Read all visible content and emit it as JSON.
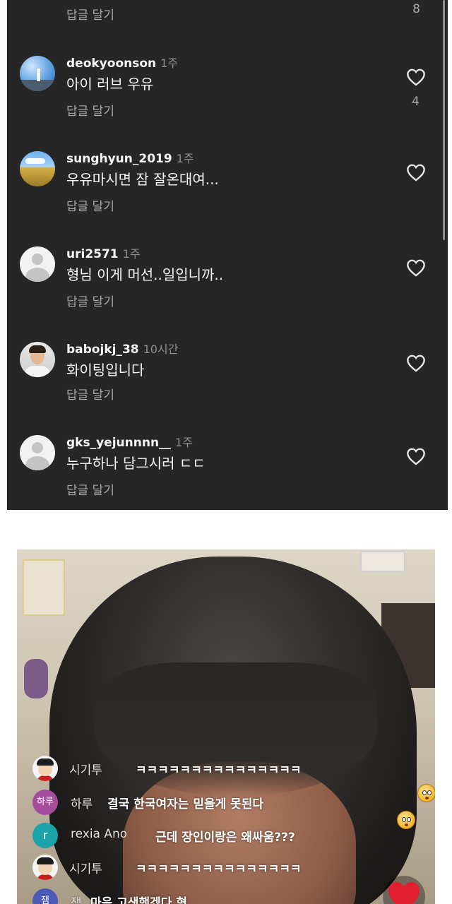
{
  "comments_panel": {
    "top_partial": {
      "reply_label": "답글 달기",
      "like_count": "8"
    },
    "comments": [
      {
        "username": "deokyoonson",
        "time": "1주",
        "text": "아이 러브 우유",
        "reply_label": "답글 달기",
        "like_count": "4"
      },
      {
        "username": "sunghyun_2019",
        "time": "1주",
        "text": "우유마시면 잠 잘온대여...",
        "reply_label": "답글 달기"
      },
      {
        "username": "uri2571",
        "time": "1주",
        "text": "형님 이게 머선..일입니까..",
        "reply_label": "답글 달기"
      },
      {
        "username": "babojkj_38",
        "time": "10시간",
        "text": "화이팅입니다",
        "reply_label": "답글 달기"
      },
      {
        "username": "gks_yejunnnn__",
        "time": "1주",
        "text": "누구하나 담그시러 ㄷㄷ",
        "reply_label": "답글 달기"
      }
    ],
    "colors": {
      "background": "#262626",
      "text": "#f5f5f5",
      "muted": "#a8a8a8"
    }
  },
  "live_chat": {
    "messages": [
      {
        "avatar_text": "",
        "username": "시기투",
        "text": "ㅋㅋㅋㅋㅋㅋㅋㅋㅋㅋㅋㅋㅋㅋㅋ"
      },
      {
        "avatar_text": "하루",
        "username": "하루",
        "text": "결국 한국여자는 믿을게 못된다"
      },
      {
        "avatar_text": "r",
        "username": "rexia Ano",
        "text": "근데 장인이랑은 왜싸움???"
      },
      {
        "avatar_text": "",
        "username": "시기투",
        "text": "ㅋㅋㅋㅋㅋㅋㅋㅋㅋㅋㅋㅋㅋㅋㅋ"
      },
      {
        "avatar_text": "잼",
        "username": "잼",
        "text": "마음 고생했겠다 형"
      }
    ]
  }
}
